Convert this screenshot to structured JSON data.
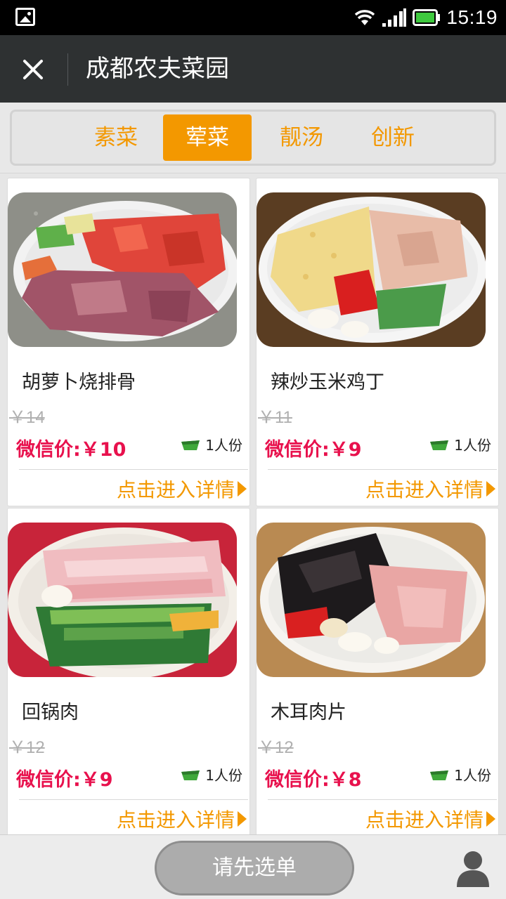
{
  "status_bar": {
    "time": "15:19",
    "icons": [
      "gallery-icon",
      "wifi-icon",
      "signal-icon",
      "battery-icon"
    ]
  },
  "header": {
    "title": "成都农夫菜园",
    "close_icon": "close-icon"
  },
  "tabs": [
    {
      "label": "素菜",
      "active": false
    },
    {
      "label": "荤菜",
      "active": true
    },
    {
      "label": "靓汤",
      "active": false
    },
    {
      "label": "创新",
      "active": false
    }
  ],
  "dishes": [
    {
      "name": "胡萝卜烧排骨",
      "original_price": "￥14",
      "wechat_price": "微信价:￥10",
      "portion": "1人份",
      "detail_label": "点击进入详情"
    },
    {
      "name": "辣炒玉米鸡丁",
      "original_price": "￥11",
      "wechat_price": "微信价:￥9",
      "portion": "1人份",
      "detail_label": "点击进入详情"
    },
    {
      "name": "回锅肉",
      "original_price": "￥12",
      "wechat_price": "微信价:￥9",
      "portion": "1人份",
      "detail_label": "点击进入详情"
    },
    {
      "name": "木耳肉片",
      "original_price": "￥12",
      "wechat_price": "微信价:￥8",
      "portion": "1人份",
      "detail_label": "点击进入详情"
    }
  ],
  "bottom_bar": {
    "order_button": "请先选单",
    "user_icon": "user-icon"
  },
  "colors": {
    "accent": "#f39800",
    "price": "#e8114d",
    "header_bg": "#2e3132"
  }
}
